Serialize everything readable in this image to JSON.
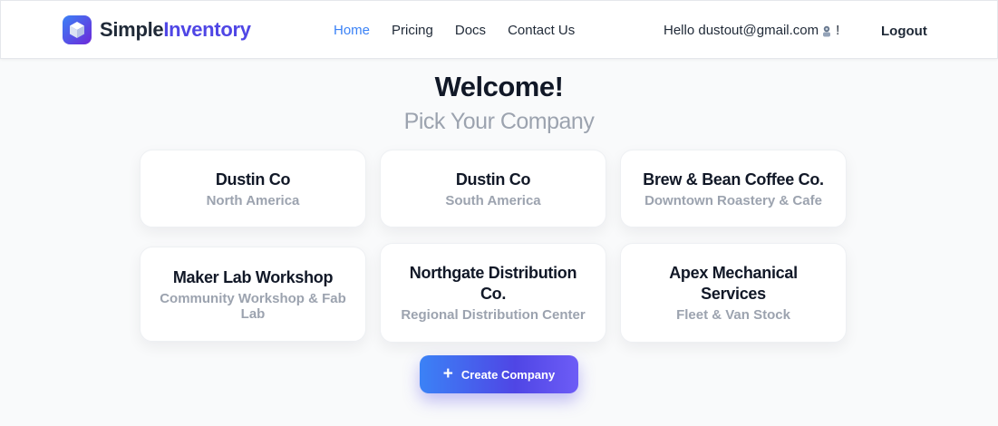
{
  "header": {
    "brand_simple": "Simple",
    "brand_inventory": "Inventory",
    "logo_icon": "cube-icon",
    "nav": [
      {
        "label": "Home",
        "active": true
      },
      {
        "label": "Pricing",
        "active": false
      },
      {
        "label": "Docs",
        "active": false
      },
      {
        "label": "Contact Us",
        "active": false
      }
    ],
    "greeting_prefix": "Hello dustout@gmail.com",
    "greeting_suffix": "!",
    "avatar_icon": "user-avatar-icon",
    "logout_label": "Logout"
  },
  "main": {
    "title": "Welcome!",
    "subtitle": "Pick Your Company",
    "companies": [
      {
        "name": "Dustin Co",
        "description": "North America"
      },
      {
        "name": "Dustin Co",
        "description": "South America"
      },
      {
        "name": "Brew & Bean Coffee Co.",
        "description": "Downtown Roastery & Cafe"
      },
      {
        "name": "Maker Lab Workshop",
        "description": "Community Workshop & Fab Lab"
      },
      {
        "name": "Northgate Distribution Co.",
        "description": "Regional Distribution Center"
      },
      {
        "name": "Apex Mechanical Services",
        "description": "Fleet & Van Stock"
      }
    ],
    "create_button_label": "Create Company",
    "create_button_icon": "plus-icon"
  },
  "colors": {
    "accent": "#4f46e5",
    "link_active": "#3b82f6",
    "muted_text": "#9ca3af"
  }
}
